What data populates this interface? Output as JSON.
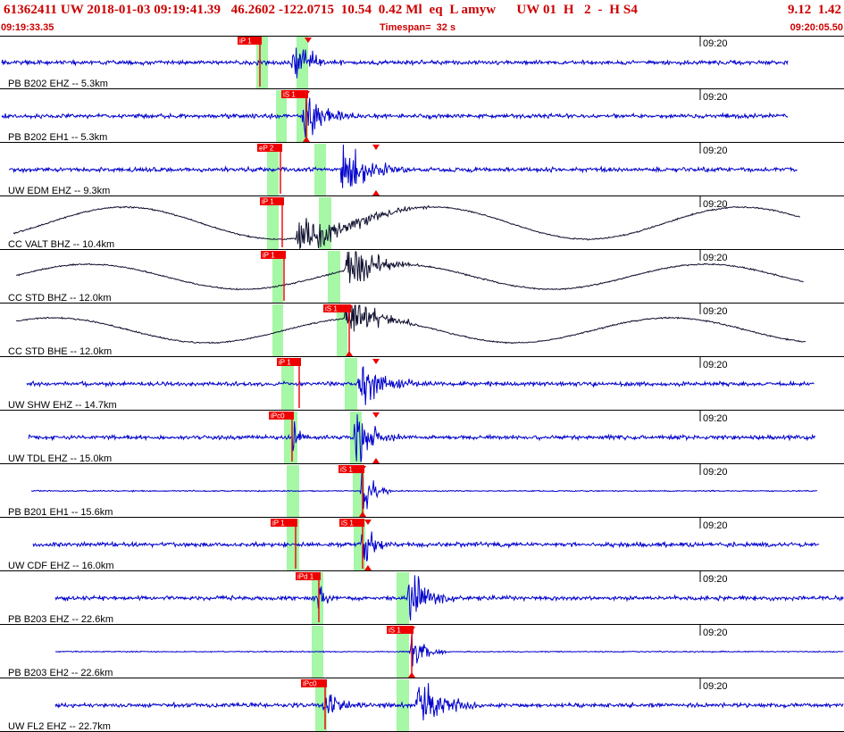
{
  "header": {
    "title": "61362411 UW 2018-01-03 09:19:41.39   46.2602 -122.0715  10.54  0.42 Ml  eq  L amyw      UW 01  H   2  -  H S4",
    "title_right": "9.12  1.42",
    "start_time": "09:19:33.35",
    "timespan": "Timespan=  32 s",
    "end_time": "09:20:05.50"
  },
  "plot": {
    "minute_mark_label": "09:20",
    "colors": {
      "grid": "#000000",
      "trace_blue": "#0000cc",
      "trace_dark": "#101030",
      "pick_red": "#ee0000",
      "pick_window_green": "#a6f7a6"
    },
    "rows": [
      {
        "label": "PB B202 EHZ -- 5.3km",
        "trace_color": "blue",
        "picks": [
          {
            "text": "iP 1"
          }
        ]
      },
      {
        "label": "PB B202 EH1 -- 5.3km",
        "trace_color": "blue",
        "picks": [
          {
            "text": "iS 1"
          }
        ]
      },
      {
        "label": "UW EDM EHZ -- 9.3km",
        "trace_color": "blue",
        "picks": [
          {
            "text": "eP 2"
          }
        ]
      },
      {
        "label": "CC VALT BHZ -- 10.4km",
        "trace_color": "dark",
        "picks": [
          {
            "text": "iP 1"
          }
        ]
      },
      {
        "label": "CC STD BHZ -- 12.0km",
        "trace_color": "dark",
        "picks": [
          {
            "text": "iP 1"
          }
        ]
      },
      {
        "label": "CC STD BHE -- 12.0km",
        "trace_color": "dark",
        "picks": [
          {
            "text": "iS 1"
          }
        ]
      },
      {
        "label": "UW SHW EHZ -- 14.7km",
        "trace_color": "blue",
        "picks": [
          {
            "text": "iP 1"
          }
        ]
      },
      {
        "label": "UW TDL EHZ -- 15.0km",
        "trace_color": "blue",
        "picks": [
          {
            "text": "iPc0"
          }
        ]
      },
      {
        "label": "PB B201 EH1 -- 15.6km",
        "trace_color": "blue",
        "picks": [
          {
            "text": "iS 1"
          }
        ]
      },
      {
        "label": "UW CDF EHZ -- 16.0km",
        "trace_color": "blue",
        "picks": [
          {
            "text": "iP 1"
          },
          {
            "text": "iS 1"
          }
        ]
      },
      {
        "label": "PB B203 EHZ -- 22.6km",
        "trace_color": "blue",
        "picks": [
          {
            "text": "iPd 1"
          }
        ]
      },
      {
        "label": "PB B203 EH2 -- 22.6km",
        "trace_color": "blue",
        "picks": [
          {
            "text": "iS 1"
          }
        ]
      },
      {
        "label": "UW FL2 EHZ -- 22.7km",
        "trace_color": "blue",
        "picks": [
          {
            "text": "iPc0"
          }
        ]
      }
    ]
  }
}
